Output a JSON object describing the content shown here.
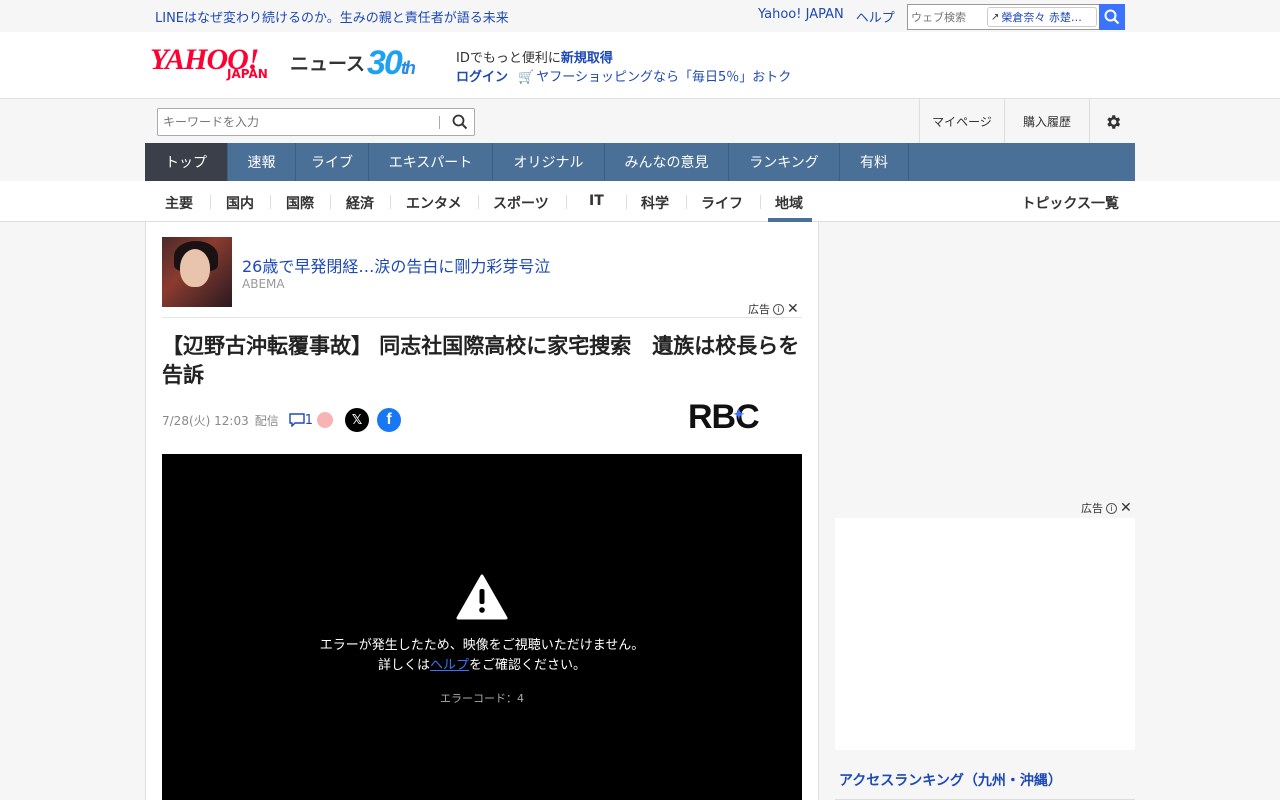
{
  "topbar": {
    "promo": "LINEはなぜ変わり続けるのか。生みの親と責任者が語る未来",
    "links": [
      "Yahoo! JAPAN",
      "ヘルプ"
    ],
    "search_placeholder": "ウェブ検索",
    "search_chip": "榮倉奈々 赤楚…"
  },
  "header": {
    "logo_text": "YAHOO!",
    "logo_sub": "JAPAN",
    "news_label": "ニュース",
    "anniv_num": "30",
    "anniv_suffix": "th",
    "id_text": "IDでもっと便利に",
    "id_link": "新規取得",
    "login": "ログイン",
    "shopping": "ヤフーショッピングなら「毎日5％」おトク"
  },
  "subhead": {
    "keyword_placeholder": "キーワードを入力",
    "mypage": "マイページ",
    "purchase": "購入履歴"
  },
  "nav": [
    {
      "label": "トップ",
      "active": true
    },
    {
      "label": "速報",
      "active": false
    },
    {
      "label": "ライブ",
      "active": false
    },
    {
      "label": "エキスパート",
      "active": false
    },
    {
      "label": "オリジナル",
      "active": false
    },
    {
      "label": "みんなの意見",
      "active": false
    },
    {
      "label": "ランキング",
      "active": false
    },
    {
      "label": "有料",
      "active": false
    }
  ],
  "categories": [
    "主要",
    "国内",
    "国際",
    "経済",
    "エンタメ",
    "スポーツ",
    "IT",
    "科学",
    "ライフ",
    "地域"
  ],
  "topics_link": "トピックス一覧",
  "ad": {
    "title": "26歳で早発閉経…涙の告白に剛力彩芽号泣",
    "source": "ABEMA",
    "label": "広告"
  },
  "article": {
    "headline": "【辺野古沖転覆事故】 同志社国際高校に家宅捜索　遺族は校長らを告訴",
    "date": "7/28(火) 12:03",
    "pub": "配信",
    "comment_count": "1",
    "publisher_logo": "RBC"
  },
  "video": {
    "error_line1": "エラーが発生したため、映像をご視聴いただけません。",
    "error_pre": "詳しくは",
    "error_link": "ヘルプ",
    "error_post": "をご確認ください。",
    "error_code": "エラーコード：4"
  },
  "right": {
    "ad_label": "広告",
    "ranking_title": "アクセスランキング（九州・沖縄）"
  }
}
